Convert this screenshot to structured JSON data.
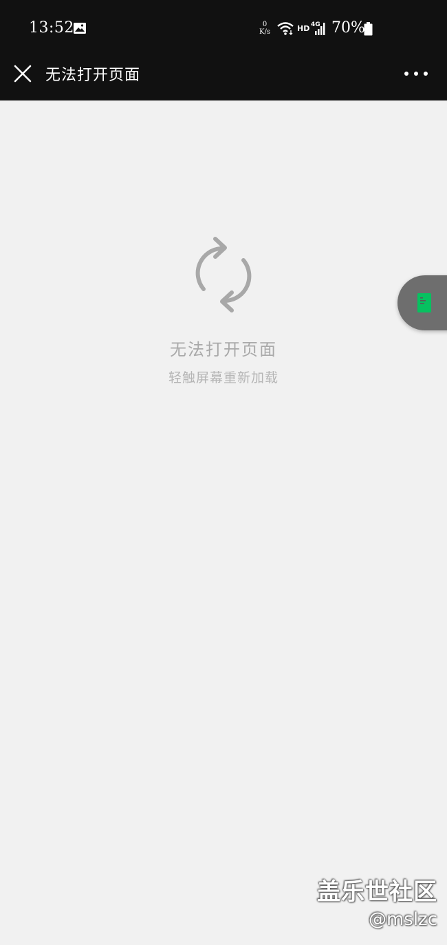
{
  "status_bar": {
    "time": "13:52",
    "gallery_icon": "image-icon",
    "net_speed_value": "0",
    "net_speed_unit": "K/s",
    "wifi_icon": "wifi-icon",
    "hd_label": "HD",
    "signal_label": "4G",
    "battery_percent": "70%",
    "battery_icon": "battery-icon"
  },
  "nav": {
    "close_icon": "close-icon",
    "title": "无法打开页面",
    "more_icon": "more-dots-icon"
  },
  "error": {
    "icon": "reload-icon",
    "title": "无法打开页面",
    "hint": "轻触屏幕重新加载"
  },
  "float_tab": {
    "icon": "document-icon",
    "accent": "#07c160"
  },
  "watermark": {
    "line1": "盖乐世社区",
    "line2": "@mslzc"
  },
  "colors": {
    "bar_bg": "#111111",
    "page_bg": "#f1f1f1",
    "muted_text": "#a9a9a9"
  }
}
